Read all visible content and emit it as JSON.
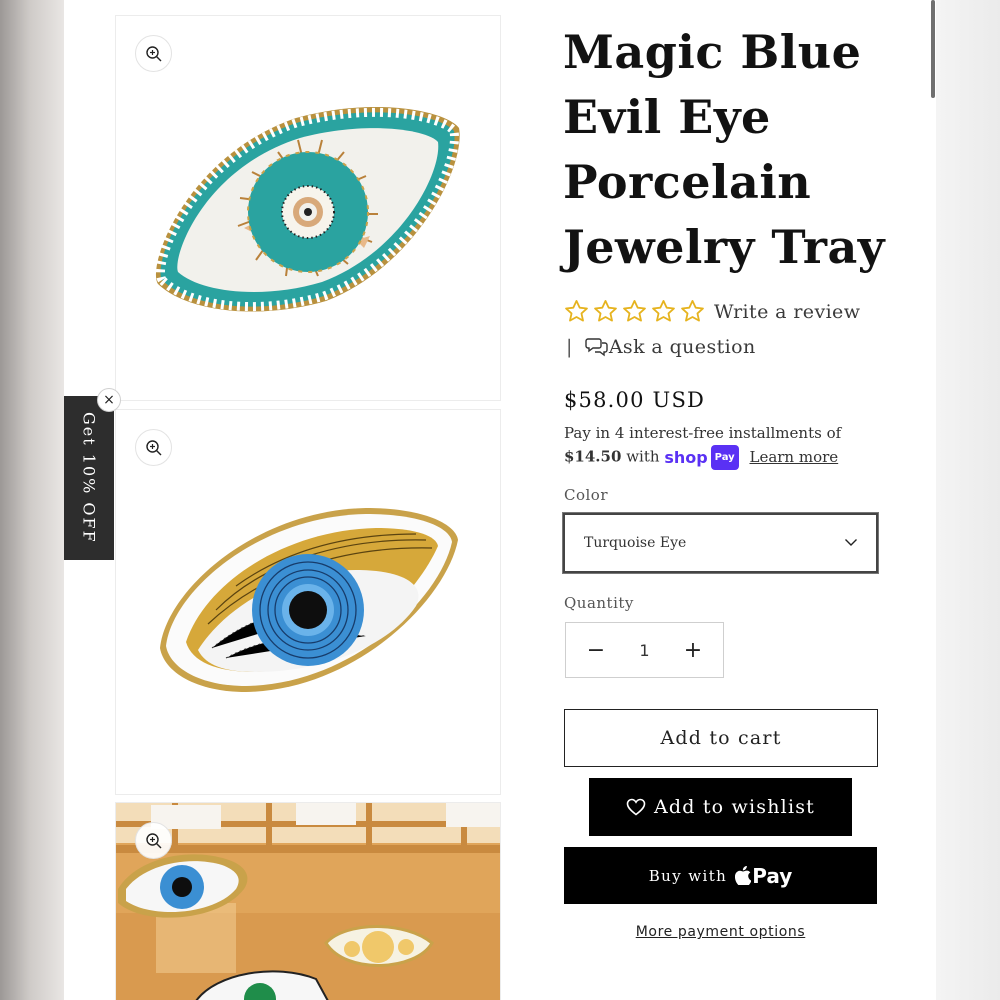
{
  "product": {
    "title": "Magic Blue Evil Eye Porcelain Jewelry Tray",
    "rating": {
      "stars_filled": 0,
      "stars_total": 5,
      "review_link": "Write a review"
    },
    "ask": {
      "separator": "|",
      "label": "Ask a question"
    },
    "price": "$58.00 USD",
    "installments": {
      "prefix": "Pay in 4 interest-free installments of",
      "amount": "$14.50",
      "with": "with",
      "shop_word": "shop",
      "shop_pay": "Pay",
      "learn_more": "Learn more"
    },
    "color": {
      "label": "Color",
      "selected": "Turquoise Eye"
    },
    "quantity": {
      "label": "Quantity",
      "value": "1",
      "minus": "−",
      "plus": "+"
    },
    "buttons": {
      "add_to_cart": "Add to cart",
      "add_to_wishlist": "Add to wishlist",
      "buy_with": "Buy with",
      "pay_word": "Pay",
      "more_payment_options": "More payment options"
    }
  },
  "promo": {
    "label": "Get 10% OFF",
    "close": "×"
  },
  "icons": {
    "zoom": "zoom-in-icon",
    "star": "star-outline-icon",
    "chat": "chat-bubbles-icon",
    "chevron": "chevron-down-icon",
    "heart": "heart-outline-icon",
    "apple": "apple-logo-icon"
  },
  "colors": {
    "star": "#e6b31e",
    "turquoise": "#2aa3a0",
    "eye_blue": "#3b8fd3",
    "gold": "#c9a24a",
    "shop_purple": "#5a31f4"
  }
}
